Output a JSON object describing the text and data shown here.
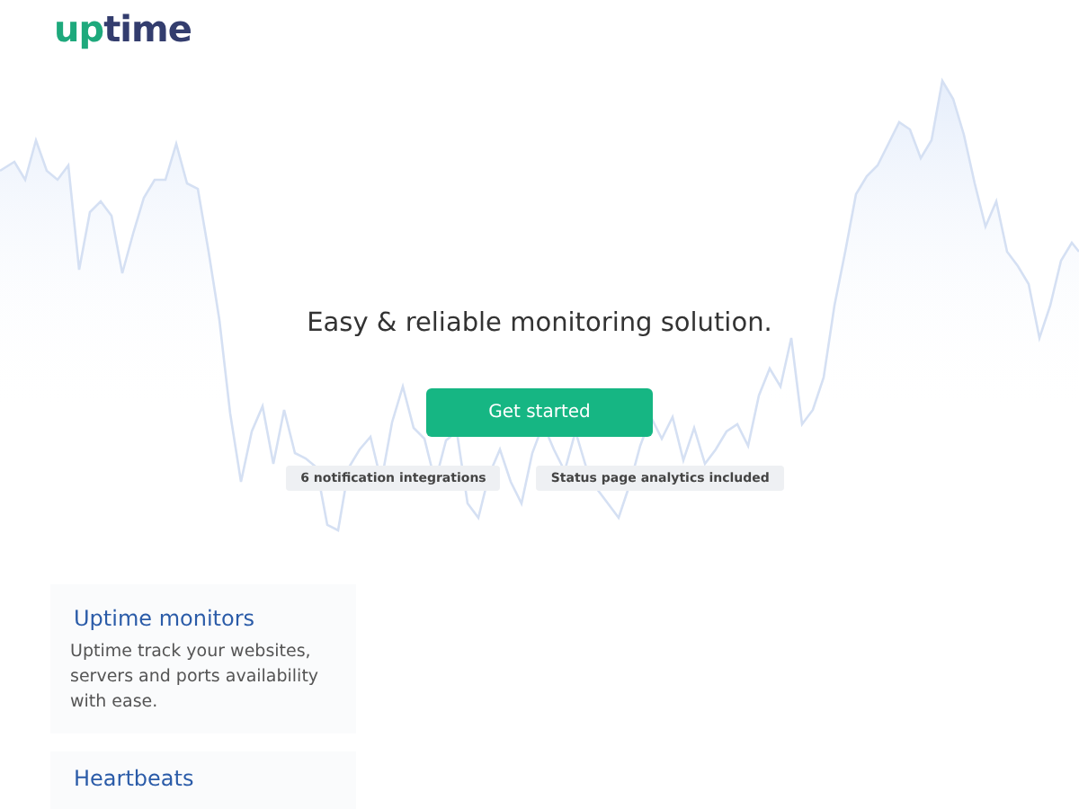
{
  "logo": {
    "part_1": "up",
    "part_2": "time"
  },
  "hero": {
    "headline": "Easy & reliable monitoring solution.",
    "button": "Get started",
    "badges": [
      "6 notification integrations",
      "Status page analytics included"
    ]
  },
  "features": [
    {
      "title": "Uptime monitors",
      "text": "Uptime track your websites, servers and ports availability with ease."
    },
    {
      "title": "Heartbeats"
    }
  ]
}
